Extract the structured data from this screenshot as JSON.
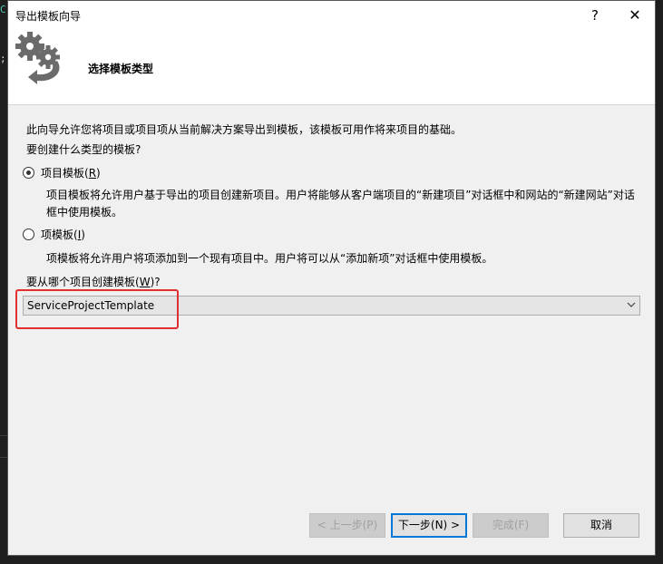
{
  "ide": {
    "glyph1": "C",
    "glyph2": ";"
  },
  "window": {
    "title": "导出模板向导",
    "help_label": "?",
    "close_label": "✕"
  },
  "header": {
    "title": "选择模板类型",
    "icon": "gear-arrow-icon"
  },
  "content": {
    "intro": "此向导允许您将项目或项目项从当前解决方案导出到模板，该模板可用作将来项目的基础。",
    "question": "要创建什么类型的模板?",
    "option_project": {
      "label": "项目模板",
      "accel": "R",
      "checked": true,
      "description": "项目模板将允许用户基于导出的项目创建新项目。用户将能够从客户端项目的“新建项目”对话框中和网站的“新建网站”对话框中使用模板。"
    },
    "option_item": {
      "label": "项模板",
      "accel": "I",
      "checked": false,
      "description": "项模板将允许用户将项添加到一个现有项目中。用户将可以从“添加新项”对话框中使用模板。"
    },
    "source_prompt": {
      "label": "要从哪个项目创建模板",
      "accel": "W",
      "suffix": "?"
    },
    "source_value": "ServiceProjectTemplate",
    "highlight_color": "#e03030"
  },
  "buttons": {
    "back": "< 上一步(P)",
    "next": "下一步(N) >",
    "finish": "完成(F)",
    "cancel": "取消"
  }
}
